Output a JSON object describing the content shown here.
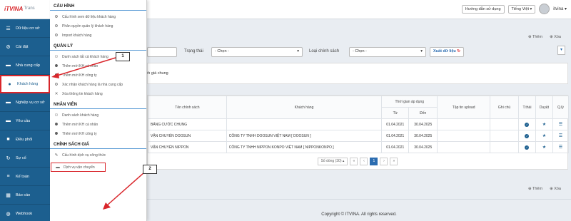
{
  "brand": {
    "logo": "iTVINA",
    "sub": "- Trans"
  },
  "topbar": {
    "guide": "Hướng dẫn sử dụng",
    "language": "Tiếng Việt",
    "user": "itvina"
  },
  "sidebar": {
    "items": [
      {
        "icon": "database-icon",
        "label": "Dữ liệu cơ sở"
      },
      {
        "icon": "gear-icon",
        "label": "Cài đặt"
      },
      {
        "icon": "truck-icon",
        "label": "Nhà cung cấp"
      },
      {
        "icon": "user-icon",
        "label": "Khách hàng"
      },
      {
        "icon": "truck-icon",
        "label": "Nghiệp vụ cơ sở"
      },
      {
        "icon": "truck-icon",
        "label": "Yêu cầu"
      },
      {
        "icon": "cube-icon",
        "label": "Điều phối"
      },
      {
        "icon": "refresh-icon",
        "label": "Sự cố"
      },
      {
        "icon": "list-icon",
        "label": "Kế toán"
      },
      {
        "icon": "chart-icon",
        "label": "Báo cáo"
      },
      {
        "icon": "globe-icon",
        "label": "Webhook"
      }
    ]
  },
  "menu": {
    "sections": [
      {
        "title": "CẤU HÌNH",
        "items": [
          {
            "icon": "gear-icon",
            "label": "Cấu hình xem dữ liệu khách hàng"
          },
          {
            "icon": "gear-icon",
            "label": "Phân quyền quản lý khách hàng"
          },
          {
            "icon": "gear-icon",
            "label": "Import khách hàng"
          }
        ]
      },
      {
        "title": "QUẢN LÝ",
        "items": [
          {
            "icon": "users-icon",
            "label": "Danh sách tất cả khách hàng"
          },
          {
            "icon": "user-add-icon",
            "label": "Thêm mới KH cá nhân"
          },
          {
            "icon": "user-add-icon",
            "label": "Thêm mới KH công ty"
          },
          {
            "icon": "gear-icon",
            "label": "Xác nhận khách hàng là nhà cung cấp"
          },
          {
            "icon": "close-icon",
            "label": "Xóa thông tin khách hàng"
          }
        ]
      },
      {
        "title": "NHÂN VIÊN",
        "items": [
          {
            "icon": "users-icon",
            "label": "Danh sách khách hàng"
          },
          {
            "icon": "user-add-icon",
            "label": "Thêm mới KH cá nhân"
          },
          {
            "icon": "user-add-icon",
            "label": "Thêm mới KH công ty"
          }
        ]
      },
      {
        "title": "CHÍNH SÁCH GIÁ",
        "items": [
          {
            "icon": "wrench-icon",
            "label": "Cấu hình dịch vụ công thức"
          },
          {
            "icon": "truck-icon",
            "label": "Dịch vụ vận chuyển"
          }
        ]
      }
    ]
  },
  "actions": {
    "add": "Thêm",
    "delete": "Xóa"
  },
  "filter": {
    "status_label": "Trạng thái",
    "status_value": "- Chọn -",
    "policy_type_label": "Loại chính sách",
    "policy_type_value": "- Chọn -",
    "export_button": "Xuất dữ liệu"
  },
  "panel": {
    "text": "ích giá chung"
  },
  "table": {
    "headers": {
      "policy_name": "Tên chính sách",
      "customer": "Khách hàng",
      "period": "Thời gian áp dụng",
      "from": "Từ",
      "to": "Đến",
      "file": "Tập tin upload",
      "note": "Ghi chú",
      "status": "T.thái",
      "approve": "Duyệt",
      "manage": "Q.lý"
    },
    "rows": [
      {
        "policy_name": "BẢNG CƯỚC CHUNG",
        "customer": "",
        "from": "01.04.2021",
        "to": "30.04.2025"
      },
      {
        "policy_name": "VẬN CHUYỂN DOOSUN",
        "customer": "CÔNG TY TNHH DOOSUN VIỆT NAM [ DOOSUN ]",
        "from": "01.04.2021",
        "to": "30.04.2025"
      },
      {
        "policy_name": "VẬN CHUYỂN NIPPON",
        "customer": "CÔNG TY TNHH NIPPON KONPO VIỆT NAM [ NIPPONKONPO ]",
        "from": "01.04.2021",
        "to": "30.04.2025"
      }
    ],
    "pager": {
      "rows_label": "Số dòng (30)",
      "page": "1"
    }
  },
  "footer": {
    "copyright": "Copyright © ITVINA. All rights reserved."
  },
  "callouts": [
    "1",
    "2"
  ],
  "colors": {
    "sidebar": "#1c5f8f",
    "annotation": "#d9262b",
    "accent": "#2b6cb0"
  }
}
